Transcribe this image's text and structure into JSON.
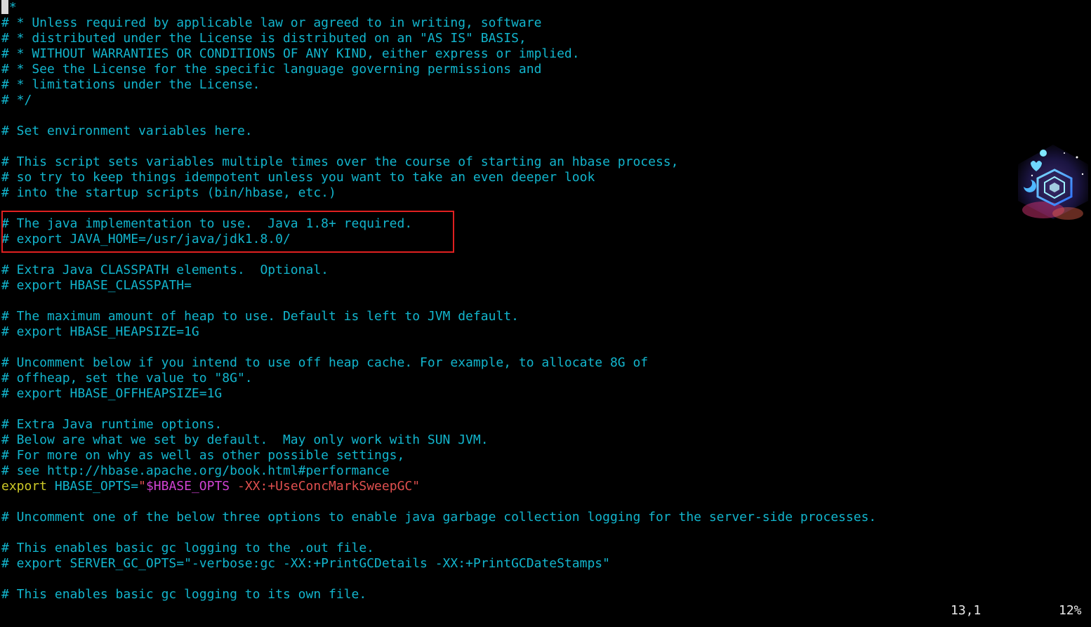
{
  "editor": {
    "lines": [
      [
        {
          "t": "comment",
          "v": " *"
        }
      ],
      [
        {
          "t": "comment",
          "v": "# * Unless required by applicable law or agreed to in writing, software"
        }
      ],
      [
        {
          "t": "comment",
          "v": "# * distributed under the License is distributed on an \"AS IS\" BASIS,"
        }
      ],
      [
        {
          "t": "comment",
          "v": "# * WITHOUT WARRANTIES OR CONDITIONS OF ANY KIND, either express or implied."
        }
      ],
      [
        {
          "t": "comment",
          "v": "# * See the License for the specific language governing permissions and"
        }
      ],
      [
        {
          "t": "comment",
          "v": "# * limitations under the License."
        }
      ],
      [
        {
          "t": "comment",
          "v": "# */"
        }
      ],
      [
        {
          "t": "comment",
          "v": ""
        }
      ],
      [
        {
          "t": "comment",
          "v": "# Set environment variables here."
        }
      ],
      [
        {
          "t": "comment",
          "v": ""
        }
      ],
      [
        {
          "t": "comment",
          "v": "# This script sets variables multiple times over the course of starting an hbase process,"
        }
      ],
      [
        {
          "t": "comment",
          "v": "# so try to keep things idempotent unless you want to take an even deeper look"
        }
      ],
      [
        {
          "t": "comment",
          "v": "# into the startup scripts (bin/hbase, etc.)"
        }
      ],
      [
        {
          "t": "comment",
          "v": ""
        }
      ],
      [
        {
          "t": "comment",
          "v": "# The java implementation to use.  Java 1.8+ required."
        }
      ],
      [
        {
          "t": "comment",
          "v": "# export JAVA_HOME=/usr/java/jdk1.8.0/"
        }
      ],
      [
        {
          "t": "comment",
          "v": ""
        }
      ],
      [
        {
          "t": "comment",
          "v": "# Extra Java CLASSPATH elements.  Optional."
        }
      ],
      [
        {
          "t": "comment",
          "v": "# export HBASE_CLASSPATH="
        }
      ],
      [
        {
          "t": "comment",
          "v": ""
        }
      ],
      [
        {
          "t": "comment",
          "v": "# The maximum amount of heap to use. Default is left to JVM default."
        }
      ],
      [
        {
          "t": "comment",
          "v": "# export HBASE_HEAPSIZE=1G"
        }
      ],
      [
        {
          "t": "comment",
          "v": ""
        }
      ],
      [
        {
          "t": "comment",
          "v": "# Uncomment below if you intend to use off heap cache. For example, to allocate 8G of"
        }
      ],
      [
        {
          "t": "comment",
          "v": "# offheap, set the value to \"8G\"."
        }
      ],
      [
        {
          "t": "comment",
          "v": "# export HBASE_OFFHEAPSIZE=1G"
        }
      ],
      [
        {
          "t": "comment",
          "v": ""
        }
      ],
      [
        {
          "t": "comment",
          "v": "# Extra Java runtime options."
        }
      ],
      [
        {
          "t": "comment",
          "v": "# Below are what we set by default.  May only work with SUN JVM."
        }
      ],
      [
        {
          "t": "comment",
          "v": "# For more on why as well as other possible settings,"
        }
      ],
      [
        {
          "t": "comment",
          "v": "# see http://hbase.apache.org/book.html#performance"
        }
      ],
      [
        {
          "t": "keyword",
          "v": "export"
        },
        {
          "t": "plain",
          "v": " "
        },
        {
          "t": "ident",
          "v": "HBASE_OPTS"
        },
        {
          "t": "plain",
          "v": "="
        },
        {
          "t": "string",
          "v": "\""
        },
        {
          "t": "var",
          "v": "$HBASE_OPTS"
        },
        {
          "t": "string",
          "v": " -XX:+UseConcMarkSweepGC\""
        }
      ],
      [
        {
          "t": "comment",
          "v": ""
        }
      ],
      [
        {
          "t": "comment",
          "v": "# Uncomment one of the below three options to enable java garbage collection logging for the server-side processes."
        }
      ],
      [
        {
          "t": "comment",
          "v": ""
        }
      ],
      [
        {
          "t": "comment",
          "v": "# This enables basic gc logging to the .out file."
        }
      ],
      [
        {
          "t": "comment",
          "v": "# export SERVER_GC_OPTS=\"-verbose:gc -XX:+PrintGCDetails -XX:+PrintGCDateStamps\""
        }
      ],
      [
        {
          "t": "comment",
          "v": ""
        }
      ],
      [
        {
          "t": "comment",
          "v": "# This enables basic gc logging to its own file."
        }
      ]
    ]
  },
  "status": {
    "position": "13,1",
    "percent": "12%"
  },
  "colors": {
    "background": "#000000",
    "comment": "#12b5cd",
    "keyword": "#cdc927",
    "string": "#e0504f",
    "variable": "#d043d2",
    "highlight_box": "#e02020"
  }
}
